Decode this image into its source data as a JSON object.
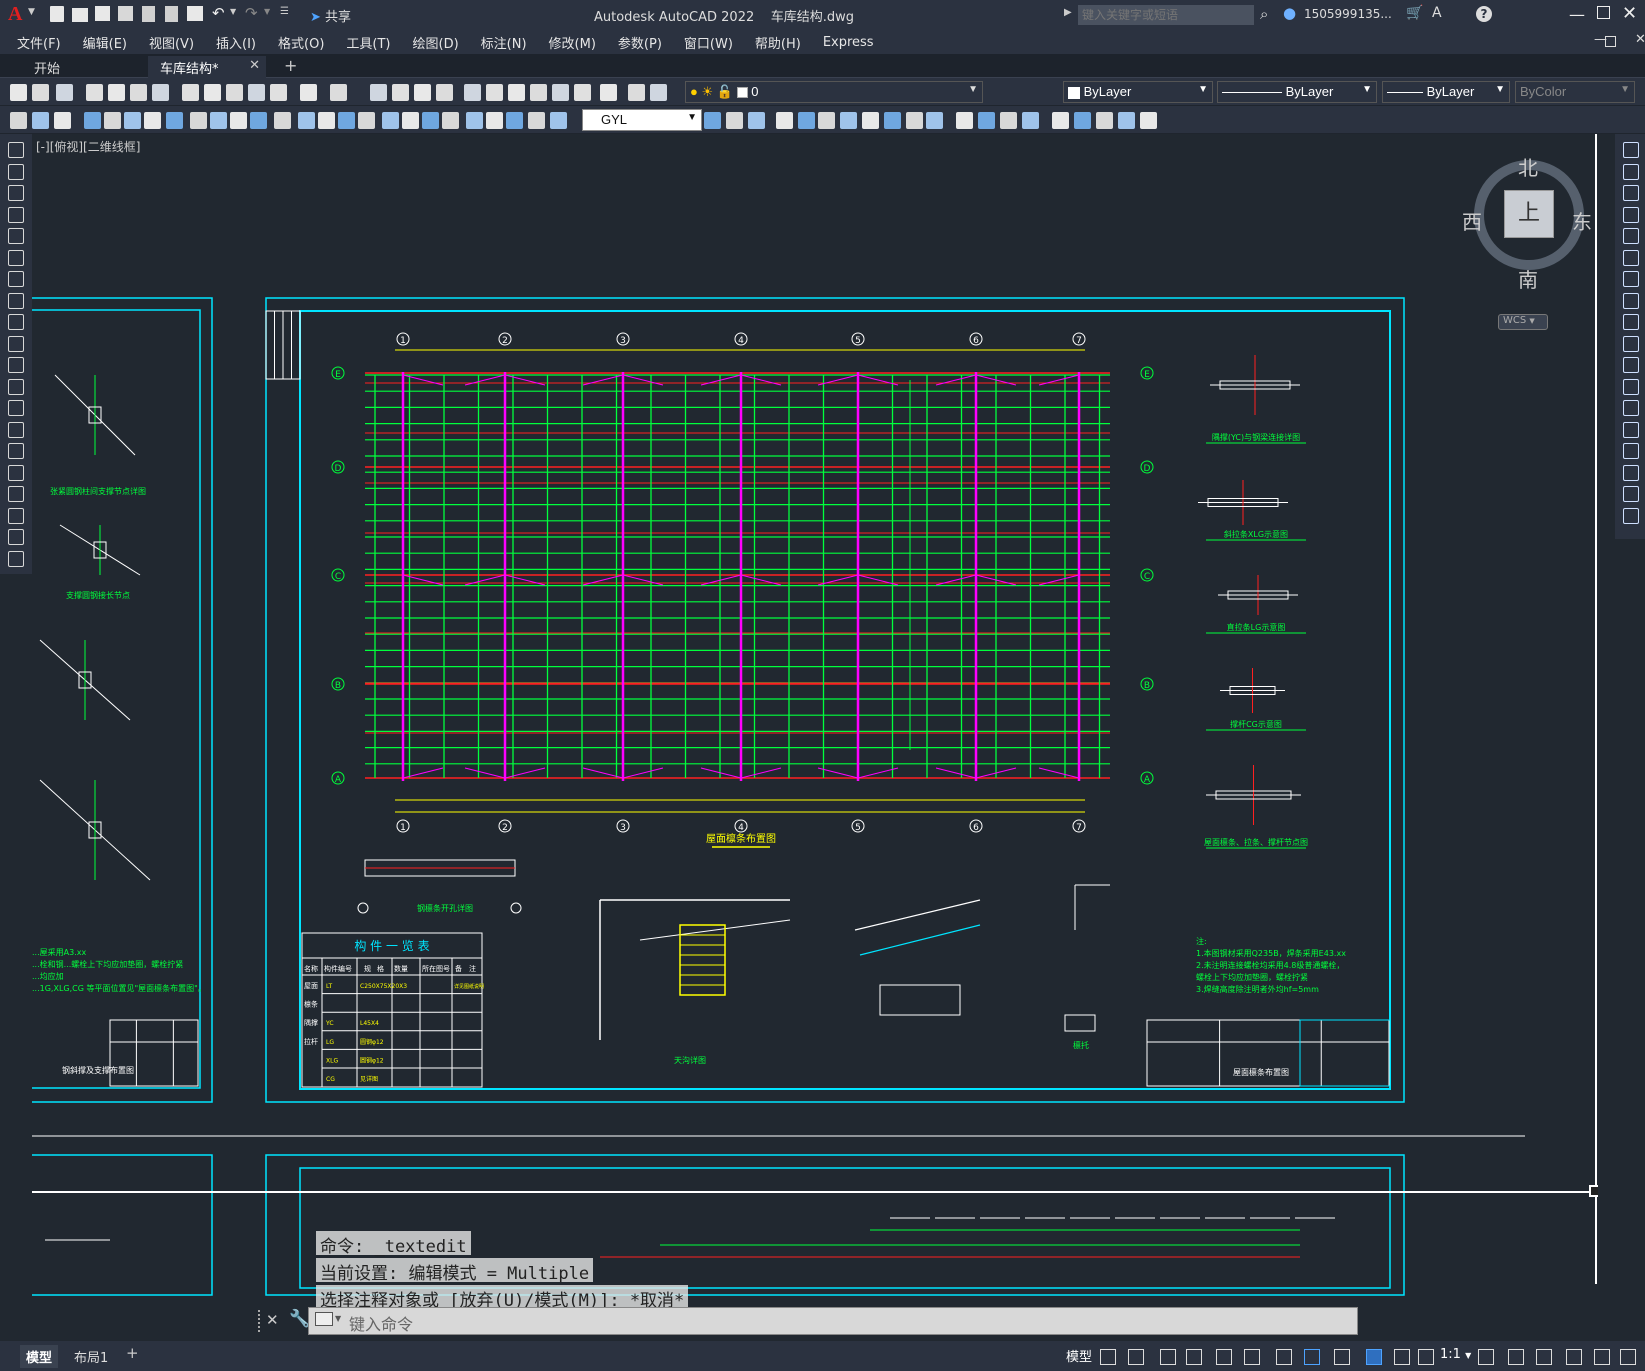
{
  "title": {
    "app": "Autodesk AutoCAD 2022",
    "file": "车库结构.dwg",
    "share": "共享",
    "search_placeholder": "键入关键字或短语",
    "user": "1505999135...",
    "app_logo": "A"
  },
  "menu": [
    "文件(F)",
    "编辑(E)",
    "视图(V)",
    "插入(I)",
    "格式(O)",
    "工具(T)",
    "绘图(D)",
    "标注(N)",
    "修改(M)",
    "参数(P)",
    "窗口(W)",
    "帮助(H)",
    "Express"
  ],
  "tabs": [
    {
      "label": "开始"
    },
    {
      "label": "车库结构*"
    }
  ],
  "toolbar": {
    "layer": "0",
    "color": "ByLayer",
    "linetype": "ByLayer",
    "lineweight": "ByLayer",
    "plotstyle": "ByColor",
    "dimstyle": "GYL"
  },
  "viewport_label": "[-][俯视][二维线框]",
  "viewcube": {
    "north": "北",
    "south": "南",
    "east": "东",
    "west": "西",
    "face": "上",
    "wcs": "WCS"
  },
  "drawing": {
    "plan_title": "屋面檩条布置图",
    "axes_numbers": [
      "1",
      "2",
      "3",
      "4",
      "5",
      "6",
      "7"
    ],
    "axes_letters": [
      "E",
      "D",
      "C",
      "B",
      "A"
    ],
    "table_title": "构 件 一 览 表",
    "table_headers": [
      "名称",
      "构件编号",
      "规",
      "格",
      "数量",
      "所在图号",
      "备",
      "注"
    ],
    "table_rows": [
      [
        "屋面",
        "LT",
        "C250X75X20X3",
        "",
        "",
        "",
        "详见图纸说明"
      ],
      [
        "檩条",
        "",
        "",
        "",
        "",
        "",
        ""
      ],
      [
        "隅撑",
        "YC",
        "L45X4",
        "",
        "",
        "",
        ""
      ],
      [
        "拉杆",
        "LG",
        "圆钢φ12",
        "",
        "",
        "",
        ""
      ],
      [
        "",
        "XLG",
        "圆钢φ12",
        "",
        "",
        "",
        ""
      ],
      [
        "",
        "CG",
        "见详图",
        "",
        "",
        "",
        ""
      ]
    ],
    "details_right": [
      "隅撑(YC)与钢梁连接详图",
      "斜拉条XLG示意图",
      "直拉条LG示意图",
      "撑杆CG示意图",
      "屋面檩条、拉条、撑杆节点图"
    ],
    "details_left": [
      "张紧圆钢柱间支撑节点详图",
      "支撑圆钢接长节点",
      "钢斜撑及支撑布置图"
    ],
    "details_bottom": [
      "钢檩条开孔详图",
      "天沟详图",
      "檩托"
    ],
    "notes_left": [
      "...屋采用A3.xx",
      "...栓和钢...螺栓上下均应加垫圈，螺栓拧紧",
      "...均应加",
      "...1G,XLG,CG 等平面位置见\"屋面檩条布置图\"。"
    ],
    "notes_right": [
      "注:",
      "1.本图钢材采用Q235B，焊条采用E43.xx",
      "2.未注明连接螺栓均采用4.8级普通螺栓，",
      "  螺栓上下均应加垫圈，螺栓拧紧",
      "3.焊缝高度除注明者外均hf=5mm"
    ]
  },
  "command": {
    "lines": [
      "命令: _textedit",
      "当前设置: 编辑模式 = Multiple",
      "选择注释对象或 [放弃(U)/模式(M)]: *取消*"
    ],
    "placeholder": "键入命令"
  },
  "status": {
    "layout_tabs": [
      "模型",
      "布局1"
    ],
    "model_button": "模型",
    "scale": "1:1"
  }
}
